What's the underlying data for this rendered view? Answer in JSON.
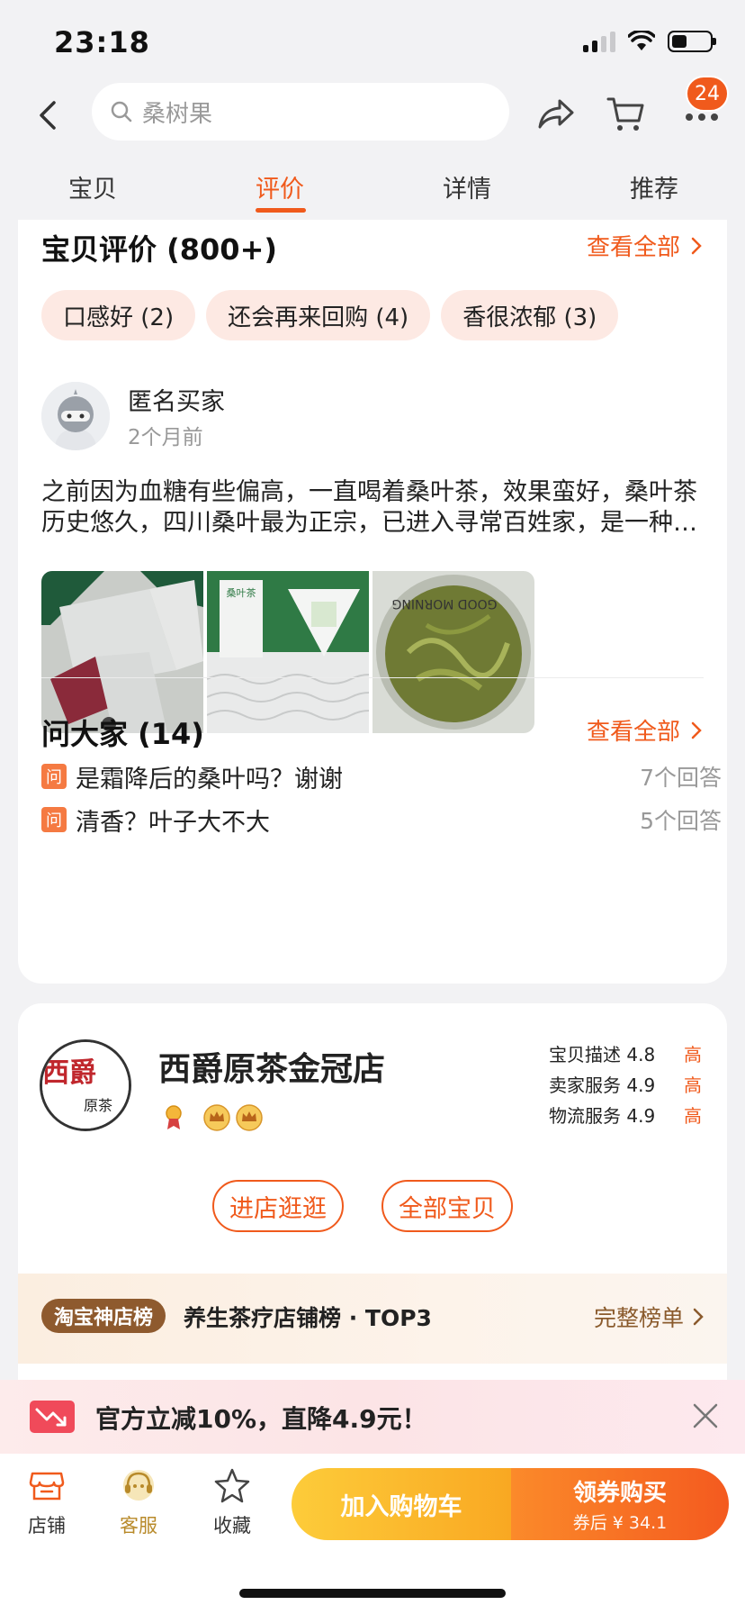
{
  "status_bar": {
    "time": "23:18"
  },
  "search": {
    "placeholder": "桑树果"
  },
  "cart_badge": "24",
  "tabs": [
    {
      "label": "宝贝",
      "active": false
    },
    {
      "label": "评价",
      "active": true
    },
    {
      "label": "详情",
      "active": false
    },
    {
      "label": "推荐",
      "active": false
    }
  ],
  "reviews": {
    "title": "宝贝评价 (800+)",
    "see_all": "查看全部",
    "tags": [
      "口感好 (2)",
      "还会再来回购 (4)",
      "香很浓郁 (3)"
    ],
    "item": {
      "user": "匿名买家",
      "time": "2个月前",
      "text": "之前因为血糖有些偏高，一直喝着桑叶茶，效果蛮好，桑叶茶历史悠久，四川桑叶最为正宗，已进入寻常百姓家，是一种很好的养生茶饮。",
      "photos": [
        "tea-packets-photo",
        "tea-box-photo",
        "tea-cup-photo"
      ],
      "photo_box_label": "桑叶茶",
      "photo_cup_print": "GOOD MORNING"
    }
  },
  "qa": {
    "title": "问大家 (14)",
    "see_all": "查看全部",
    "badge": "问",
    "items": [
      {
        "question": "是霜降后的桑叶吗？谢谢",
        "answers": "7个回答"
      },
      {
        "question": "清香？叶子大不大",
        "answers": "5个回答"
      }
    ]
  },
  "store": {
    "name": "西爵原茶金冠店",
    "logo_text": "西爵",
    "logo_sub": "原茶",
    "ratings": [
      {
        "label": "宝贝描述",
        "score": "4.8",
        "level": "高"
      },
      {
        "label": "卖家服务",
        "score": "4.9",
        "level": "高"
      },
      {
        "label": "物流服务",
        "score": "4.9",
        "level": "高"
      }
    ],
    "buttons": {
      "enter": "进店逛逛",
      "all_items": "全部宝贝"
    },
    "ranking": {
      "badge": "淘宝神店榜",
      "text": "养生茶疗店铺榜 · TOP3",
      "link": "完整榜单"
    }
  },
  "promo": {
    "text": "官方立减10%，直降4.9元！"
  },
  "bottom_bar": {
    "shop": "店铺",
    "service": "客服",
    "favorite": "收藏",
    "add_cart": "加入购物车",
    "buy": "领券购买",
    "buy_sub": "券后 ¥ 34.1"
  },
  "colors": {
    "accent": "#f05a1c",
    "tag_bg": "#fde9e3",
    "gold": "#b88a2a"
  }
}
